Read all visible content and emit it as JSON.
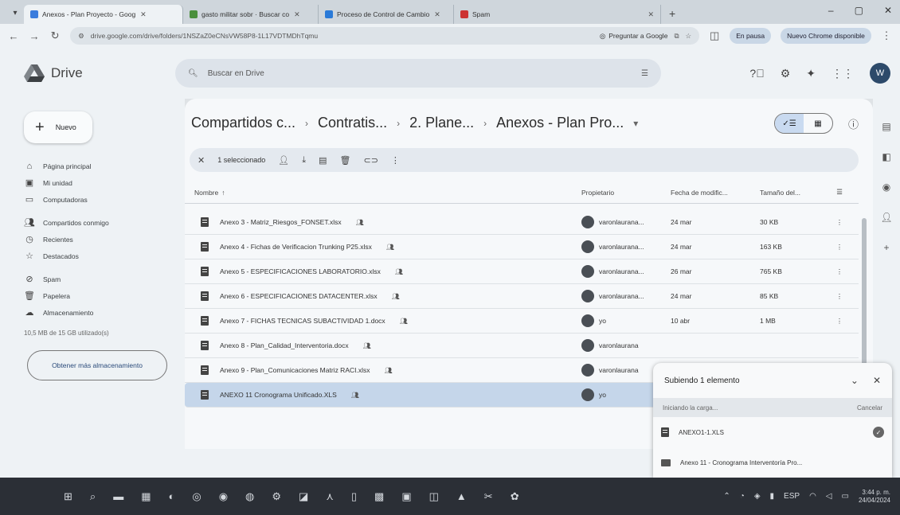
{
  "browser": {
    "tabs": [
      {
        "label": "Anexos - Plan Proyecto - Goog",
        "color": "#3b7ddd",
        "active": true
      },
      {
        "label": "gasto militar sobr · Buscar co",
        "color": "#4a8f3c",
        "active": false
      },
      {
        "label": "Proceso de Control de Cambio",
        "color": "#2a7ad8",
        "active": false
      },
      {
        "label": "Spam",
        "color": "#c33",
        "active": false
      }
    ],
    "url": "drive.google.com/drive/folders/1NSZaZ0eCNsVW58P8-1L17VDTMDhTqmu",
    "ask_google": "Preguntar a Google",
    "incognito": "En pausa",
    "update": "Nuevo Chrome disponible"
  },
  "drive": {
    "logo_text": "Drive",
    "search_placeholder": "Buscar en Drive",
    "avatar_letter": "W"
  },
  "sidebar": {
    "new_label": "Nuevo",
    "items": [
      {
        "label": "Página principal",
        "icon": "home-icon"
      },
      {
        "label": "Mi unidad",
        "icon": "drive-icon"
      },
      {
        "label": "Computadoras",
        "icon": "computer-icon"
      },
      {
        "label": "Compartidos conmigo",
        "icon": "people-icon"
      },
      {
        "label": "Recientes",
        "icon": "clock-icon"
      },
      {
        "label": "Destacados",
        "icon": "star-icon"
      },
      {
        "label": "Spam",
        "icon": "spam-icon"
      },
      {
        "label": "Papelera",
        "icon": "trash-icon"
      },
      {
        "label": "Almacenamiento",
        "icon": "cloud-icon"
      }
    ],
    "storage_text": "10,5 MB de 15 GB utilizado(s)",
    "storage_button": "Obtener más almacenamiento"
  },
  "main": {
    "breadcrumb": [
      "Compartidos c...",
      "Contratis...",
      "2. Plane...",
      "Anexos - Plan Pro..."
    ],
    "selection_label": "1 seleccionado",
    "columns": {
      "name": "Nombre",
      "owner": "Propietario",
      "date": "Fecha de modific...",
      "size": "Tamaño del..."
    },
    "files": [
      {
        "name": "Anexo 3 - Matriz_Riesgos_FONSET.xlsx",
        "owner": "varonlaurana...",
        "date": "24 mar",
        "size": "30 KB",
        "selected": false
      },
      {
        "name": "Anexo 4 - Fichas de Verificacion Trunking P25.xlsx",
        "owner": "varonlaurana...",
        "date": "24 mar",
        "size": "163 KB",
        "selected": false
      },
      {
        "name": "Anexo 5 - ESPECIFICACIONES LABORATORIO.xlsx",
        "owner": "varonlaurana...",
        "date": "26 mar",
        "size": "765 KB",
        "selected": false
      },
      {
        "name": "Anexo 6 - ESPECIFICACIONES DATACENTER.xlsx",
        "owner": "varonlaurana...",
        "date": "24 mar",
        "size": "85 KB",
        "selected": false
      },
      {
        "name": "Anexo 7 - FICHAS TECNICAS SUBACTIVIDAD 1.docx",
        "owner": "yo",
        "date": "10 abr",
        "size": "1 MB",
        "selected": false
      },
      {
        "name": "Anexo 8 - Plan_Calidad_Interventoria.docx",
        "owner": "varonlaurana",
        "date": "",
        "size": "",
        "selected": false
      },
      {
        "name": "Anexo 9 - Plan_Comunicaciones Matriz RACI.xlsx",
        "owner": "varonlaurana",
        "date": "",
        "size": "",
        "selected": false
      },
      {
        "name": "ANEXO 11 Cronograma Unificado.XLS",
        "owner": "yo",
        "date": "",
        "size": "",
        "selected": true
      }
    ]
  },
  "upload": {
    "title": "Subiendo 1 elemento",
    "status": "Iniciando la carga...",
    "cancel": "Cancelar",
    "items": [
      {
        "name": "ANEXO1-1.XLS",
        "type": "file"
      },
      {
        "name": "Anexo 11 - Cronograma Interventoría Pro...",
        "type": "folder"
      }
    ]
  },
  "taskbar": {
    "language": "ESP",
    "time": "3:44 p. m.",
    "date": "24/04/2024"
  }
}
